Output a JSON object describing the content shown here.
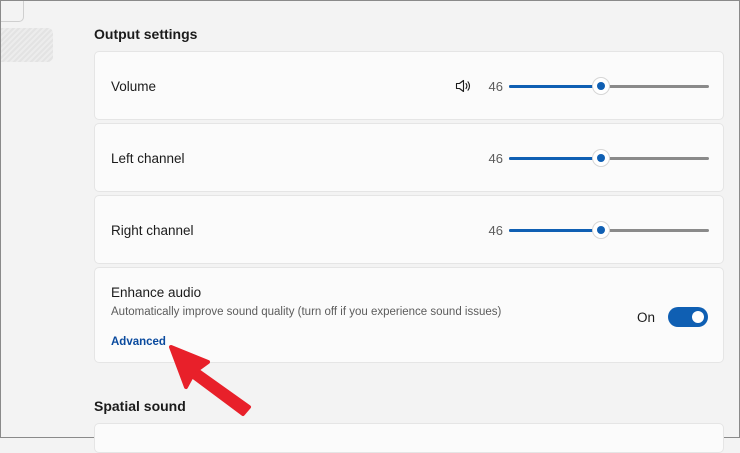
{
  "output_section": {
    "title": "Output settings"
  },
  "sliders": [
    {
      "label": "Volume",
      "value": "46",
      "level": 0.46,
      "icon": "speaker-icon"
    },
    {
      "label": "Left channel",
      "value": "46",
      "level": 0.46
    },
    {
      "label": "Right channel",
      "value": "46",
      "level": 0.46
    }
  ],
  "enhance_audio": {
    "title": "Enhance audio",
    "description": "Automatically improve sound quality (turn off if you experience sound issues)",
    "link": "Advanced",
    "state": "On",
    "enabled": true
  },
  "spatial_section": {
    "title": "Spatial sound"
  },
  "colors": {
    "accent": "#0f5fb3",
    "link": "#0a4a9e",
    "annotation_arrow": "#e8202a",
    "background": "#f3f3f3",
    "card": "#fbfbfb"
  }
}
